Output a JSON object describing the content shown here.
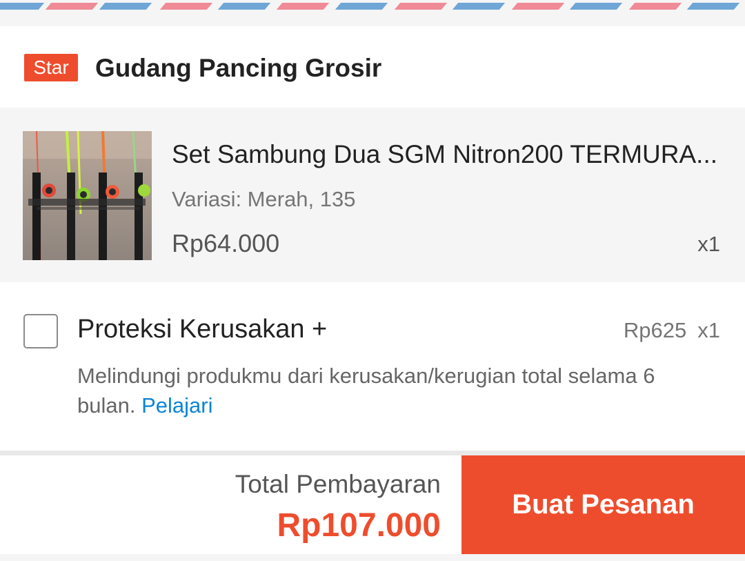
{
  "colors": {
    "accent": "#ee4d2d",
    "link": "#0a84d6",
    "stripe_red": "#f08a96",
    "stripe_blue": "#6fa6d6"
  },
  "shop": {
    "badge": "Star",
    "name": "Gudang Pancing Grosir"
  },
  "product": {
    "name": "Set Sambung Dua SGM Nitron200 TERMURA...",
    "variation": "Variasi: Merah, 135",
    "price": "Rp64.000",
    "quantity": "x1",
    "image_icon": "fishing-rods-product-photo"
  },
  "protection": {
    "title": "Proteksi Kerusakan +",
    "price": "Rp625",
    "quantity": "x1",
    "description": "Melindungi produkmu dari kerusakan/kerugian total selama 6 bulan.",
    "learn_link": "Pelajari",
    "checked": false
  },
  "footer": {
    "total_label": "Total Pembayaran",
    "total_amount": "Rp107.000",
    "order_button": "Buat Pesanan"
  }
}
